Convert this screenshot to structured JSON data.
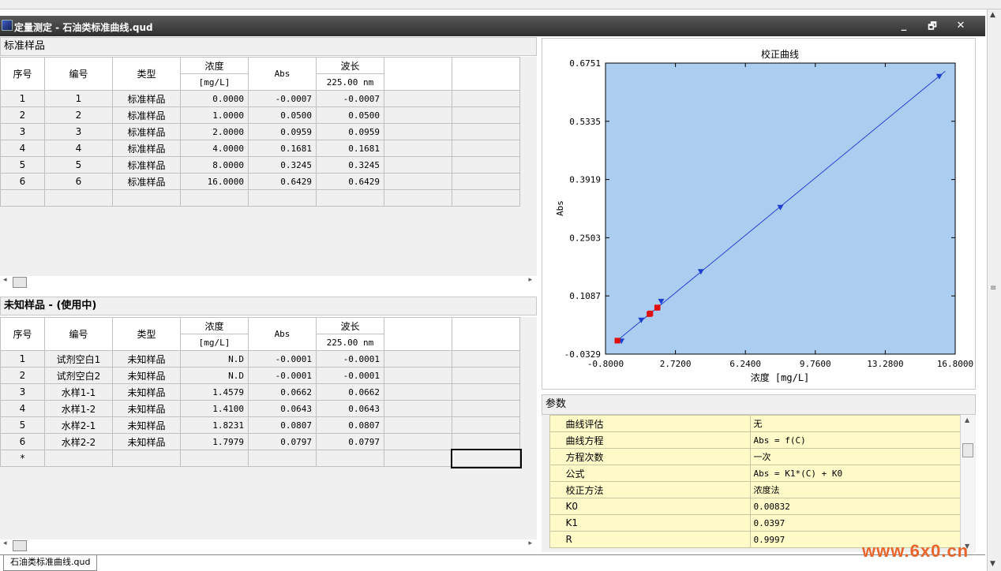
{
  "window": {
    "title": "定量测定 - 石油类标准曲线.qud",
    "minimize_glyph": "_",
    "restore_glyph": "🗗",
    "close_glyph": "✕"
  },
  "standard_section": {
    "title": "标准样品",
    "headers": [
      "序号",
      "编号",
      "类型",
      "浓度",
      "[mg/L]",
      "Abs",
      "波长",
      "225.00 nm"
    ],
    "rows": [
      [
        "1",
        "1",
        "标准样品",
        "0.0000",
        "-0.0007",
        "-0.0007"
      ],
      [
        "2",
        "2",
        "标准样品",
        "1.0000",
        "0.0500",
        "0.0500"
      ],
      [
        "3",
        "3",
        "标准样品",
        "2.0000",
        "0.0959",
        "0.0959"
      ],
      [
        "4",
        "4",
        "标准样品",
        "4.0000",
        "0.1681",
        "0.1681"
      ],
      [
        "5",
        "5",
        "标准样品",
        "8.0000",
        "0.3245",
        "0.3245"
      ],
      [
        "6",
        "6",
        "标准样品",
        "16.0000",
        "0.6429",
        "0.6429"
      ]
    ]
  },
  "unknown_section": {
    "title": "未知样品 - (使用中)",
    "headers": [
      "序号",
      "编号",
      "类型",
      "浓度",
      "[mg/L]",
      "Abs",
      "波长",
      "225.00 nm"
    ],
    "rows": [
      [
        "1",
        "试剂空白1",
        "未知样品",
        "N.D",
        "-0.0001",
        "-0.0001"
      ],
      [
        "2",
        "试剂空白2",
        "未知样品",
        "N.D",
        "-0.0001",
        "-0.0001"
      ],
      [
        "3",
        "水样1-1",
        "未知样品",
        "1.4579",
        "0.0662",
        "0.0662"
      ],
      [
        "4",
        "水样1-2",
        "未知样品",
        "1.4100",
        "0.0643",
        "0.0643"
      ],
      [
        "5",
        "水样2-1",
        "未知样品",
        "1.8231",
        "0.0807",
        "0.0807"
      ],
      [
        "6",
        "水样2-2",
        "未知样品",
        "1.7979",
        "0.0797",
        "0.0797"
      ]
    ],
    "new_row_marker": "*"
  },
  "chart_data": {
    "type": "scatter",
    "title": "校正曲线",
    "xlabel": "浓度 [mg/L]",
    "ylabel": "Abs",
    "xlim": [
      -0.8,
      16.8
    ],
    "ylim": [
      -0.0329,
      0.6751
    ],
    "xticks": [
      "-0.8000",
      "2.7200",
      "6.2400",
      "9.7600",
      "13.2800",
      "16.8000"
    ],
    "yticks": [
      "0.6751",
      "0.5335",
      "0.3919",
      "0.2503",
      "0.1087",
      "-0.0329"
    ],
    "fit_line": {
      "k0": 0.00832,
      "k1": 0.0397
    },
    "series": [
      {
        "name": "标准样品",
        "marker": "triangle",
        "color": "#1f3fd0",
        "x": [
          0,
          1,
          2,
          4,
          8,
          16
        ],
        "y": [
          -0.0007,
          0.05,
          0.0959,
          0.1681,
          0.3245,
          0.6429
        ]
      },
      {
        "name": "未知样品",
        "marker": "square",
        "color": "#e01010",
        "x": [
          -0.2,
          -0.2,
          1.4579,
          1.41,
          1.8231,
          1.7979
        ],
        "y": [
          -0.0001,
          -0.0001,
          0.0662,
          0.0643,
          0.0807,
          0.0797
        ]
      }
    ],
    "plot_bg": "#aacdf0",
    "line_color": "#2a3fd6"
  },
  "params": {
    "title": "参数",
    "rows": [
      {
        "k": "曲线评估",
        "v": "无"
      },
      {
        "k": "曲线方程",
        "v": "Abs = f(C)"
      },
      {
        "k": "方程次数",
        "v": "一次"
      },
      {
        "k": "公式",
        "v": "Abs = K1*(C) + K0"
      },
      {
        "k": "校正方法",
        "v": "浓度法"
      },
      {
        "k": "K0",
        "v": "0.00832"
      },
      {
        "k": "K1",
        "v": "0.0397"
      },
      {
        "k": "R",
        "v": "0.9997"
      }
    ]
  },
  "doc_tab": "石油类标准曲线.qud",
  "watermark": "www.6x0.cn"
}
